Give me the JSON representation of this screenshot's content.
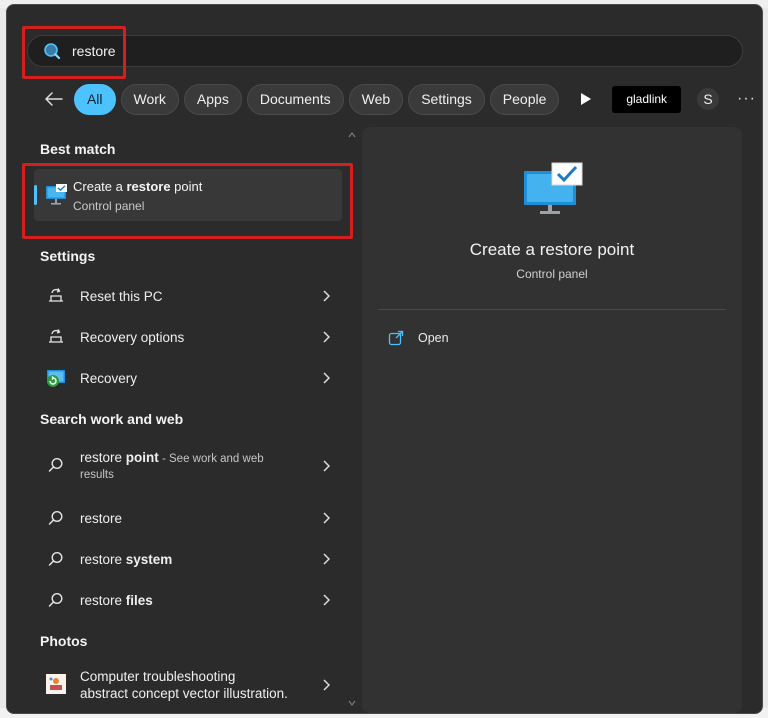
{
  "search": {
    "query": "restore"
  },
  "filters": {
    "chips": [
      "All",
      "Work",
      "Apps",
      "Documents",
      "Web",
      "Settings",
      "People"
    ],
    "active_index": 0,
    "account": "gladlink",
    "avatar_letter": "S",
    "more": "···"
  },
  "sections": {
    "best_match": "Best match",
    "settings": "Settings",
    "search_web": "Search work and web",
    "photos": "Photos"
  },
  "best_match": {
    "title_prefix": "Create a ",
    "title_bold": "restore",
    "title_suffix": " point",
    "subtitle": "Control panel"
  },
  "settings_items": [
    {
      "label": "Reset this PC",
      "icon": "reset-pc-icon"
    },
    {
      "label": "Recovery options",
      "icon": "recovery-options-icon"
    },
    {
      "label": "Recovery",
      "icon": "recovery-icon"
    }
  ],
  "web_items": [
    {
      "prefix": "restore ",
      "bold": "point",
      "suffix": " - See work and web",
      "line2": "results"
    },
    {
      "prefix": "restore",
      "bold": "",
      "suffix": ""
    },
    {
      "prefix": "restore ",
      "bold": "system",
      "suffix": ""
    },
    {
      "prefix": "restore ",
      "bold": "files",
      "suffix": ""
    }
  ],
  "photos_item": {
    "line1": "Computer troubleshooting",
    "line2": "abstract concept vector illustration."
  },
  "preview": {
    "title": "Create a restore point",
    "subtitle": "Control panel",
    "action_open": "Open"
  },
  "colors": {
    "accent": "#4cc2ff",
    "highlight": "#d41f1f",
    "panel": "#2b2b2b"
  }
}
